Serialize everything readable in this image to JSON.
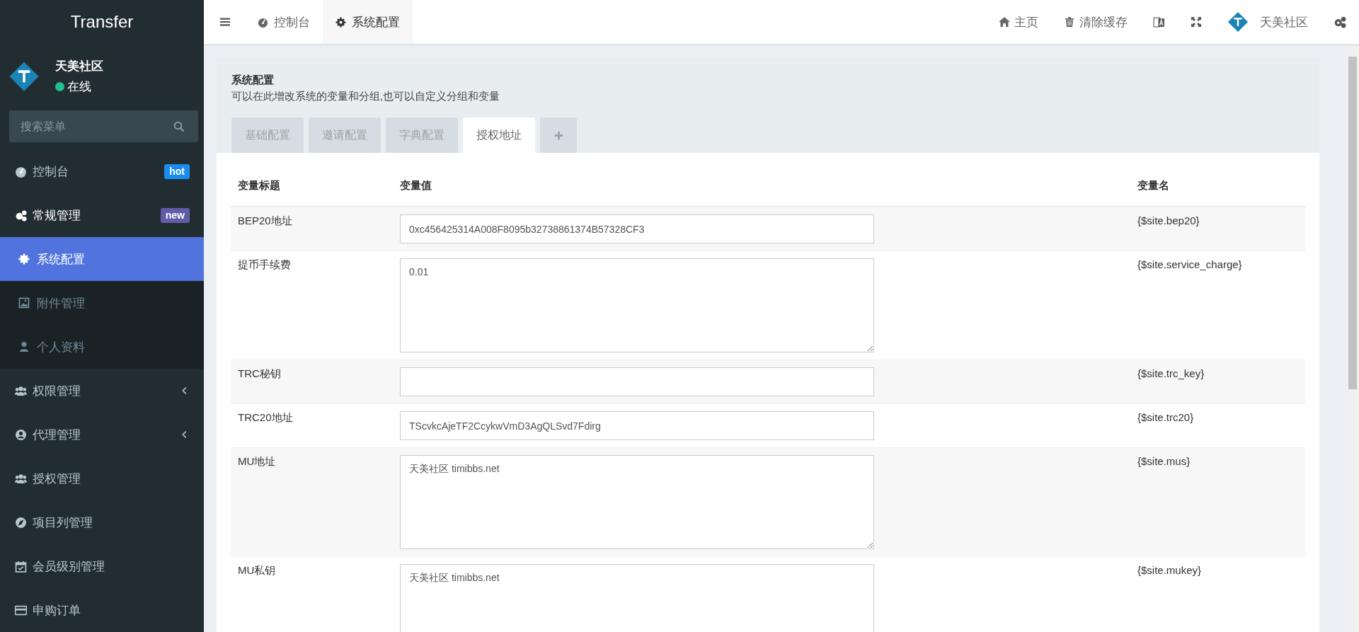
{
  "sidebar": {
    "brand": "Transfer",
    "user": {
      "name": "天美社区",
      "status": "在线",
      "online": true
    },
    "search": {
      "placeholder": "搜索菜单"
    },
    "menu": [
      {
        "label": "控制台",
        "badge": {
          "text": "hot",
          "color": "#1a8cf0"
        }
      },
      {
        "label": "常规管理",
        "badge": {
          "text": "new",
          "color": "#605ca8"
        },
        "expanded": true,
        "children": [
          {
            "label": "系统配置",
            "selected": true
          },
          {
            "label": "附件管理",
            "selected": false
          },
          {
            "label": "个人资料",
            "selected": false
          }
        ]
      },
      {
        "label": "权限管理",
        "expanded": false
      },
      {
        "label": "代理管理",
        "expanded": false
      },
      {
        "label": "授权管理"
      },
      {
        "label": "项目列管理"
      },
      {
        "label": "会员级别管理"
      },
      {
        "label": "申购订单"
      }
    ]
  },
  "topbar": {
    "tabs": [
      {
        "label": "控制台",
        "selected": false
      },
      {
        "label": "系统配置",
        "selected": true
      }
    ],
    "links": [
      {
        "kind": "home",
        "label": "主页"
      },
      {
        "kind": "trash",
        "label": "清除缓存"
      }
    ],
    "user": {
      "name": "天美社区"
    }
  },
  "panel": {
    "title": "系统配置",
    "description": "可以在此增改系统的变量和分组,也可以自定义分组和变量",
    "tabs": [
      {
        "label": "基础配置",
        "selected": false
      },
      {
        "label": "邀请配置",
        "selected": false
      },
      {
        "label": "字典配置",
        "selected": false
      },
      {
        "label": "授权地址",
        "selected": true
      }
    ],
    "table": {
      "columns": [
        "变量标题",
        "变量值",
        "变量名"
      ],
      "rows": [
        {
          "title": "BEP20地址",
          "kind": "input",
          "value": "0xc456425314A008F8095b32738861374B57328CF3",
          "name": "{$site.bep20}"
        },
        {
          "title": "提币手续费",
          "kind": "textarea",
          "value": "0.01",
          "name": "{$site.service_charge}"
        },
        {
          "title": "TRC秘钥",
          "kind": "input",
          "value": "",
          "name": "{$site.trc_key}"
        },
        {
          "title": "TRC20地址",
          "kind": "input",
          "value": "TScvkcAjeTF2CcykwVmD3AgQLSvd7Fdirg",
          "name": "{$site.trc20}"
        },
        {
          "title": "MU地址",
          "kind": "textarea",
          "value": "天美社区 timibbs.net",
          "name": "{$site.mus}"
        },
        {
          "title": "MU私钥",
          "kind": "textarea",
          "value": "天美社区 timibbs.net",
          "name": "{$site.mukey}"
        }
      ]
    }
  }
}
